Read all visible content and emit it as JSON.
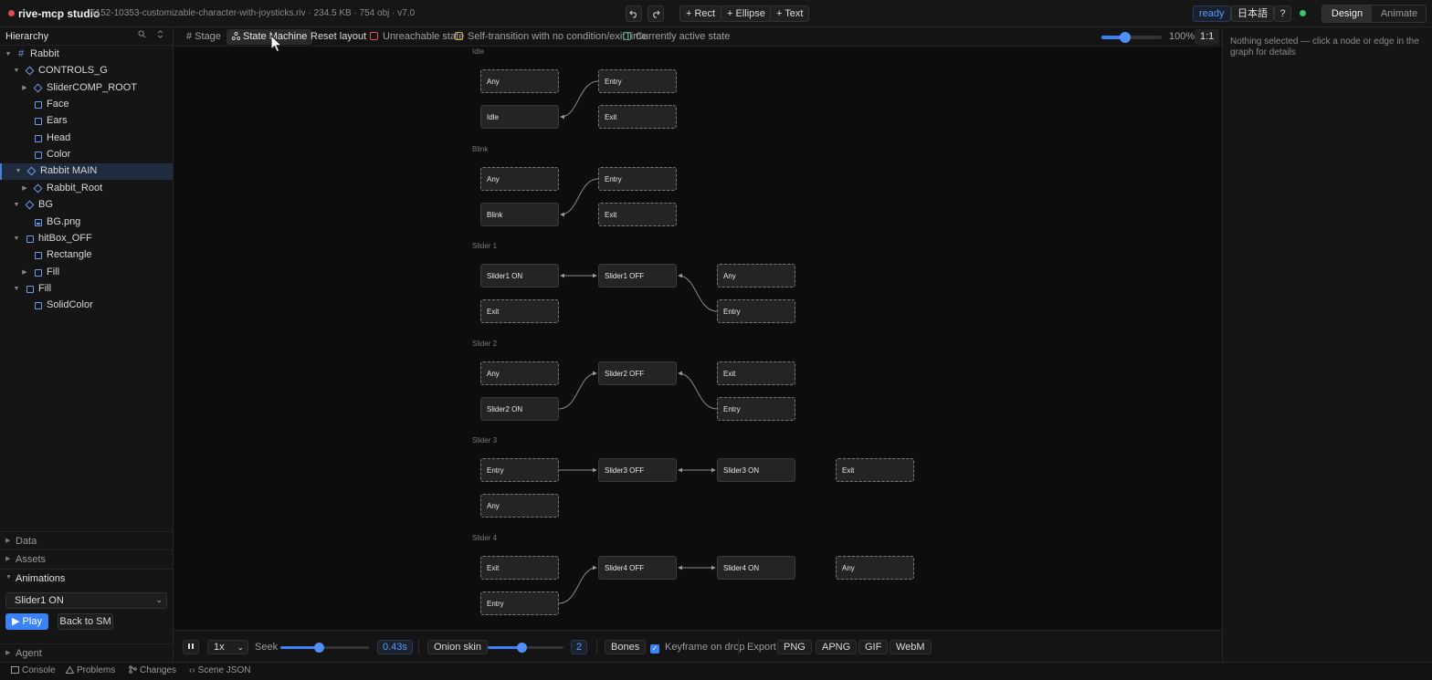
{
  "topbar": {
    "app_title": "rive-mcp studio",
    "file_meta": "5152-10353-customizable-character-with-joysticks.riv · 234.5 KB · 754 obj · v7.0",
    "undo_icon": "undo-icon",
    "redo_icon": "redo-icon",
    "add_rect": "+ Rect",
    "add_ellipse": "+ Ellipse",
    "add_text": "+ Text",
    "status": "ready",
    "language": "日本語",
    "help": "?",
    "modes": [
      "Design",
      "Animate"
    ],
    "active_mode": "Design"
  },
  "hierarchy": {
    "title": "Hierarchy",
    "items": [
      {
        "label": "Rabbit",
        "icon": "frame-icon"
      },
      {
        "label": "CONTROLS_G",
        "icon": "group-icon"
      },
      {
        "label": "SliderCOMP_ROOT",
        "icon": "group-icon"
      },
      {
        "label": "Face",
        "icon": "shape-icon"
      },
      {
        "label": "Ears",
        "icon": "shape-icon"
      },
      {
        "label": "Head",
        "icon": "shape-icon"
      },
      {
        "label": "Color",
        "icon": "shape-icon"
      },
      {
        "label": "Rabbit MAIN",
        "icon": "group-icon"
      },
      {
        "label": "Rabbit_Root",
        "icon": "group-icon"
      },
      {
        "label": "BG",
        "icon": "group-icon"
      },
      {
        "label": "BG.png",
        "icon": "image-icon"
      },
      {
        "label": "hitBox_OFF",
        "icon": "shape-icon"
      },
      {
        "label": "Rectangle",
        "icon": "shape-icon"
      },
      {
        "label": "Fill",
        "icon": "shape-icon"
      },
      {
        "label": "Fill",
        "icon": "shape-icon"
      },
      {
        "label": "SolidColor",
        "icon": "shape-icon"
      }
    ]
  },
  "sections": {
    "data": "Data",
    "assets": "Assets",
    "animations": "Animations",
    "agent": "Agent"
  },
  "animations": {
    "selected": "Slider1 ON",
    "play_label": "▶ Play",
    "back_label": "Back to SM"
  },
  "canvas_toolbar": {
    "stage": "# Stage",
    "state_machine": "State Machine",
    "reset_layout": "Reset layout",
    "legend": [
      {
        "label": "Unreachable state",
        "color": "#d9534f"
      },
      {
        "label": "Self-transition with no condition/exitTime",
        "color": "#d9a23c"
      },
      {
        "label": "Currently active state",
        "color": "#3bb56c"
      }
    ],
    "zoom": 0.4,
    "zoom_label": "100%",
    "fit_label": "1:1"
  },
  "state_machine": {
    "groups": [
      {
        "label": "Idle",
        "nodes": [
          {
            "label": "Any",
            "special": true
          },
          {
            "label": "Entry",
            "special": true
          },
          {
            "label": "Idle",
            "special": false
          },
          {
            "label": "Exit",
            "special": true
          }
        ]
      },
      {
        "label": "Blink",
        "nodes": [
          {
            "label": "Any",
            "special": true
          },
          {
            "label": "Entry",
            "special": true
          },
          {
            "label": "Blink",
            "special": false
          },
          {
            "label": "Exit",
            "special": true
          }
        ]
      },
      {
        "label": "Slider 1",
        "nodes": [
          {
            "label": "Slider1 ON",
            "special": false
          },
          {
            "label": "Slider1 OFF",
            "special": false
          },
          {
            "label": "Any",
            "special": true
          },
          {
            "label": "Exit",
            "special": true
          },
          {
            "label": "Entry",
            "special": true
          }
        ]
      },
      {
        "label": "Slider 2",
        "nodes": [
          {
            "label": "Any",
            "special": true
          },
          {
            "label": "Slider2 OFF",
            "special": false
          },
          {
            "label": "Exit",
            "special": true
          },
          {
            "label": "Slider2 ON",
            "special": false
          },
          {
            "label": "Entry",
            "special": true
          }
        ]
      },
      {
        "label": "Slider 3",
        "nodes": [
          {
            "label": "Entry",
            "special": true
          },
          {
            "label": "Slider3 OFF",
            "special": false
          },
          {
            "label": "Slider3 ON",
            "special": false
          },
          {
            "label": "Exit",
            "special": true
          },
          {
            "label": "Any",
            "special": true
          }
        ]
      },
      {
        "label": "Slider 4",
        "nodes": [
          {
            "label": "Exit",
            "special": true
          },
          {
            "label": "Slider4 OFF",
            "special": false
          },
          {
            "label": "Slider4 ON",
            "special": false
          },
          {
            "label": "Any",
            "special": true
          },
          {
            "label": "Entry",
            "special": true
          }
        ]
      }
    ]
  },
  "playback": {
    "pause_icon": "pause-icon",
    "speed": "1x",
    "seek_label": "Seek",
    "seek_fraction": 0.43,
    "seek_value": "0.43s",
    "onion_label": "Onion skin",
    "onion_fraction": 0.45,
    "onion_value": "2",
    "bones_label": "Bones",
    "keyframe_label": "Keyframe on drop",
    "keyframe_checked": true,
    "export_label": "Export",
    "formats": [
      "PNG",
      "APNG",
      "GIF",
      "WebM"
    ]
  },
  "right_panel": {
    "message": "Nothing selected — click a node or edge in the graph for details"
  },
  "statusbar": {
    "console": "Console",
    "problems": "Problems",
    "changes": "Changes",
    "scene_json": "Scene JSON"
  },
  "colors": {
    "accent": "#3b82f6",
    "status_ok": "#3bc46a",
    "record": "#e24b4b"
  }
}
